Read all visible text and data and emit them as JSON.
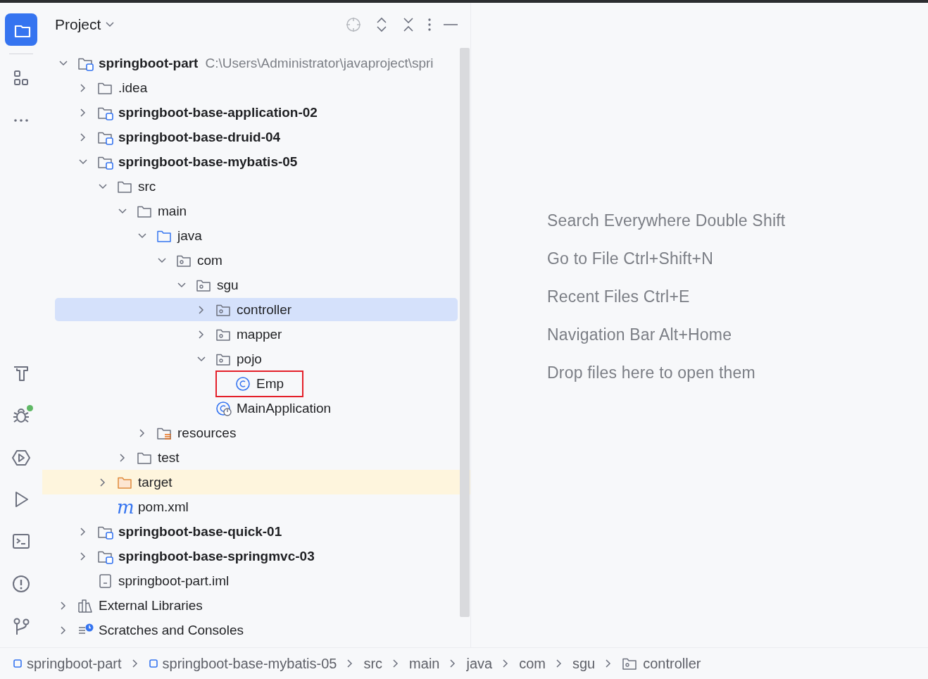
{
  "tool_stripe": [
    {
      "kind": "project",
      "selected": true
    },
    {
      "kind": "structure",
      "selected": false
    },
    {
      "kind": "more",
      "selected": false
    },
    {
      "kind": "build",
      "selected": false
    },
    {
      "kind": "debug",
      "selected": false,
      "badge": true
    },
    {
      "kind": "services",
      "selected": false
    },
    {
      "kind": "run",
      "selected": false
    },
    {
      "kind": "terminal",
      "selected": false
    },
    {
      "kind": "problems",
      "selected": false
    },
    {
      "kind": "git",
      "selected": false
    }
  ],
  "panel": {
    "title": "Project"
  },
  "tree": [
    {
      "label": "springboot-part",
      "kind": "module",
      "path": "C:\\Users\\Administrator\\javaproject\\spri",
      "expanded": true,
      "selected": false,
      "children": [
        {
          "label": ".idea",
          "kind": "folder",
          "expanded": false,
          "selected": false
        },
        {
          "label": "springboot-base-application-02",
          "kind": "module",
          "expanded": false,
          "selected": false
        },
        {
          "label": "springboot-base-druid-04",
          "kind": "module",
          "expanded": false,
          "selected": false
        },
        {
          "label": "springboot-base-mybatis-05",
          "kind": "module",
          "expanded": true,
          "selected": false,
          "children": [
            {
              "label": "src",
              "kind": "folder",
              "expanded": true,
              "selected": false,
              "children": [
                {
                  "label": "main",
                  "kind": "folder",
                  "expanded": true,
                  "selected": false,
                  "children": [
                    {
                      "label": "java",
                      "kind": "source",
                      "expanded": true,
                      "selected": false,
                      "children": [
                        {
                          "label": "com",
                          "kind": "package",
                          "expanded": true,
                          "selected": false,
                          "children": [
                            {
                              "label": "sgu",
                              "kind": "package",
                              "expanded": true,
                              "selected": false,
                              "children": [
                                {
                                  "label": "controller",
                                  "kind": "package",
                                  "expanded": false,
                                  "selected": true
                                },
                                {
                                  "label": "mapper",
                                  "kind": "package",
                                  "expanded": false,
                                  "selected": false
                                },
                                {
                                  "label": "pojo",
                                  "kind": "package",
                                  "expanded": true,
                                  "selected": false,
                                  "children": [
                                    {
                                      "label": "Emp",
                                      "kind": "class",
                                      "selected": false,
                                      "outlined": true
                                    }
                                  ]
                                },
                                {
                                  "label": "MainApplication",
                                  "kind": "main-class",
                                  "selected": false
                                }
                              ]
                            }
                          ]
                        }
                      ]
                    },
                    {
                      "label": "resources",
                      "kind": "resources",
                      "expanded": false,
                      "selected": false
                    }
                  ]
                },
                {
                  "label": "test",
                  "kind": "folder",
                  "expanded": false,
                  "selected": false
                }
              ]
            },
            {
              "label": "target",
              "kind": "excluded",
              "expanded": false,
              "selected": false
            },
            {
              "label": "pom.xml",
              "kind": "maven",
              "icon_text": "m",
              "selected": false
            }
          ]
        },
        {
          "label": "springboot-base-quick-01",
          "kind": "module",
          "expanded": false,
          "selected": false
        },
        {
          "label": "springboot-base-springmvc-03",
          "kind": "module",
          "expanded": false,
          "selected": false
        },
        {
          "label": "springboot-part.iml",
          "kind": "iml",
          "selected": false
        }
      ]
    },
    {
      "label": "External Libraries",
      "kind": "libraries",
      "expanded": false,
      "selected": false
    },
    {
      "label": "Scratches and Consoles",
      "kind": "scratches",
      "expanded": false,
      "selected": false
    }
  ],
  "editor_hints": [
    "Search Everywhere Double Shift",
    "Go to File Ctrl+Shift+N",
    "Recent Files Ctrl+E",
    "Navigation Bar Alt+Home",
    "Drop files here to open them"
  ],
  "breadcrumbs": [
    {
      "label": "springboot-part",
      "kind": "module"
    },
    {
      "label": "springboot-base-mybatis-05",
      "kind": "module"
    },
    {
      "label": "src",
      "kind": "plain"
    },
    {
      "label": "main",
      "kind": "plain"
    },
    {
      "label": "java",
      "kind": "plain"
    },
    {
      "label": "com",
      "kind": "plain"
    },
    {
      "label": "sgu",
      "kind": "plain"
    },
    {
      "label": "controller",
      "kind": "package"
    }
  ]
}
